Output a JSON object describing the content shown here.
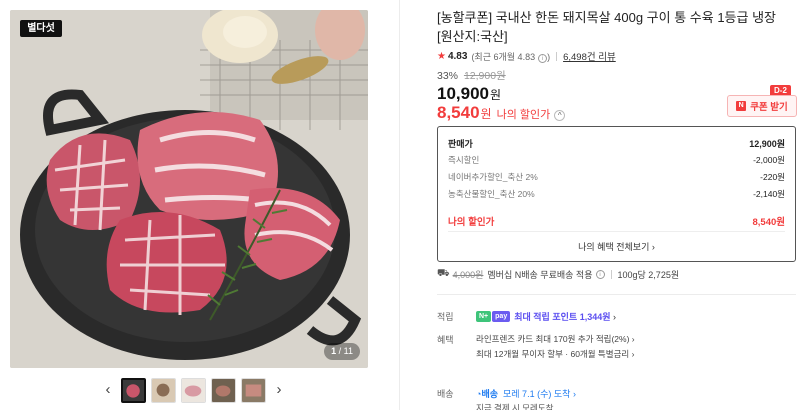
{
  "gallery": {
    "badge": "별다섯",
    "page_current": "1",
    "page_total": "11",
    "prev_arrow": "‹",
    "next_arrow": "›"
  },
  "product": {
    "title": "[농할쿠폰] 국내산 한돈 돼지목살 400g 구이 통 수육 1등급 냉장 [원산지:국산]",
    "rating": "4.83",
    "rating_detail": "(최근 6개월 4.83",
    "review_count": "6,498건 리뷰",
    "discount_rate": "33%",
    "original_price": "12,900원",
    "sale_price": "10,900",
    "won": "원",
    "my_price": "8,540",
    "my_price_label": "나의 할인가",
    "d_badge": "D-2",
    "coupon_button": "쿠폰 받기"
  },
  "price_box": {
    "rows": [
      {
        "label": "판매가",
        "value": "12,900원"
      },
      {
        "label": "즉시할인",
        "value": "-2,000원"
      },
      {
        "label": "네이버추가할인_축산 2%",
        "value": "-220원"
      },
      {
        "label": "농축산물할인_축산 20%",
        "value": "-2,140원"
      }
    ],
    "my_label": "나의 할인가",
    "my_value": "8,540원",
    "more": "나의 혜택 전체보기 ›"
  },
  "shipping": {
    "old_fee": "4,000원",
    "text": "멤버십 N배송 무료배송 적용",
    "unit_price": "100g당 2,725원"
  },
  "details": {
    "points_label": "적립",
    "nplus": "N+",
    "pay": "pay",
    "points_text": "최대 적립 포인트",
    "points_value": "1,344원",
    "benefit_label": "혜택",
    "benefit_line1": "라인프렌즈 카드 최대 170원 추가 적립(2%) ›",
    "benefit_line2": "최대 12개월 무이자 할부 · 60개월 특별금리 ›",
    "delivery_label": "배송",
    "delivery_tag": "배송",
    "delivery_date": "모레 7.1 (수) 도착",
    "delivery_sub": "지금 결제 시 모레도착"
  },
  "colors": {
    "accent_red": "#f23c3c",
    "point_purple": "#5b4ef0",
    "delivery_blue": "#1e7bf0"
  }
}
